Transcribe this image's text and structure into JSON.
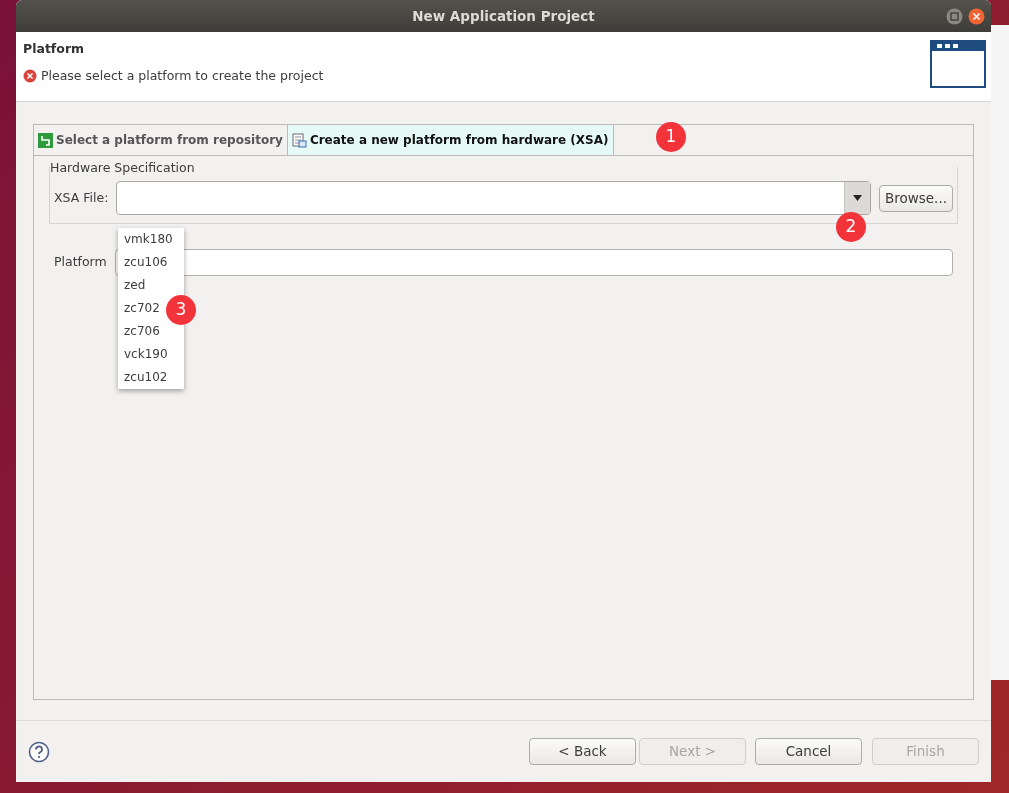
{
  "window": {
    "title": "New Application Project"
  },
  "header": {
    "title": "Platform",
    "message": "Please select a platform to create the project"
  },
  "tabs": [
    {
      "label": "Select a platform from repository",
      "selected": false
    },
    {
      "label": "Create a new platform from hardware (XSA)",
      "selected": true
    }
  ],
  "hardware_group": {
    "title": "Hardware Specification",
    "xsa_label": "XSA File:",
    "browse_button": "Browse..."
  },
  "xsa_dropdown": {
    "expanded": true,
    "options": [
      "vmk180",
      "zcu106",
      "zed",
      "zc702",
      "zc706",
      "vck190",
      "zcu102"
    ]
  },
  "platform_label": "Platform",
  "buttons": [
    {
      "label": "< Back",
      "disabled": false
    },
    {
      "label": "Next >",
      "disabled": true
    },
    {
      "label": "Cancel",
      "disabled": false
    },
    {
      "label": "Finish",
      "disabled": true
    }
  ],
  "markers": [
    "1",
    "2",
    "3"
  ]
}
